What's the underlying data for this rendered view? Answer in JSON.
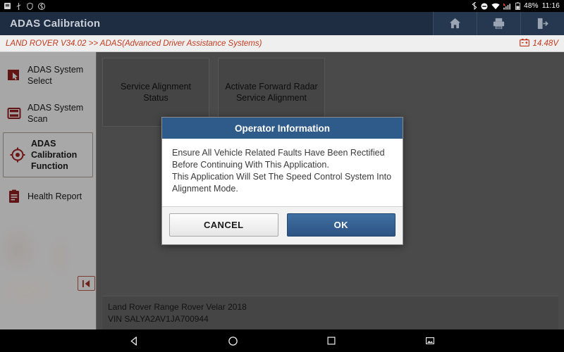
{
  "statusbar": {
    "left_icons": [
      "sd-card-icon",
      "usb-icon",
      "shield-icon",
      "bluetooth-settings-icon"
    ],
    "right_icons": [
      "bluetooth-icon",
      "do-not-disturb-icon",
      "wifi-icon",
      "signal-icon",
      "battery-icon"
    ],
    "battery_percent": "48%",
    "clock": "11:16"
  },
  "titlebar": {
    "title": "ADAS Calibration",
    "actions": [
      {
        "name": "home-button",
        "icon": "home-icon"
      },
      {
        "name": "print-button",
        "icon": "printer-icon"
      },
      {
        "name": "exit-button",
        "icon": "exit-icon"
      }
    ]
  },
  "breadcrumb": {
    "path": "LAND ROVER V34.02 >> ADAS(Advanced Driver Assistance Systems)",
    "voltage": "14.48V",
    "voltage_icon": "battery-icon",
    "accent_color": "#c33a1e"
  },
  "sidebar": {
    "collapse_label": "|K",
    "items": [
      {
        "label": "ADAS System Select",
        "icon": "cursor-select-icon",
        "selected": false
      },
      {
        "label": "ADAS System Scan",
        "icon": "scan-icon",
        "selected": false
      },
      {
        "label": "ADAS Calibration Function",
        "icon": "crosshair-target-icon",
        "selected": true
      },
      {
        "label": "Health Report",
        "icon": "clipboard-report-icon",
        "selected": false
      }
    ]
  },
  "main": {
    "cards": [
      {
        "label": "Service Alignment Status"
      },
      {
        "label": "Activate Forward Radar Service Alignment"
      }
    ],
    "vehicle": {
      "model": "Land Rover Range Rover Velar 2018",
      "vin": "VIN SALYA2AV1JA700944"
    }
  },
  "dialog": {
    "title": "Operator Information",
    "lines": [
      "Ensure All Vehicle Related Faults Have Been Rectified Before Continuing With This Application.",
      "This Application Will Set The Speed Control System Into Alignment Mode."
    ],
    "cancel_label": "CANCEL",
    "ok_label": "OK",
    "header_color": "#2f5b8b",
    "ok_color": "#2d5483"
  },
  "navbar": {
    "buttons": [
      {
        "name": "nav-back-button",
        "icon": "back-triangle-icon"
      },
      {
        "name": "nav-home-button",
        "icon": "home-circle-icon"
      },
      {
        "name": "nav-recents-button",
        "icon": "recents-square-icon"
      },
      {
        "name": "nav-screenshot-button",
        "icon": "screenshot-icon"
      }
    ]
  }
}
